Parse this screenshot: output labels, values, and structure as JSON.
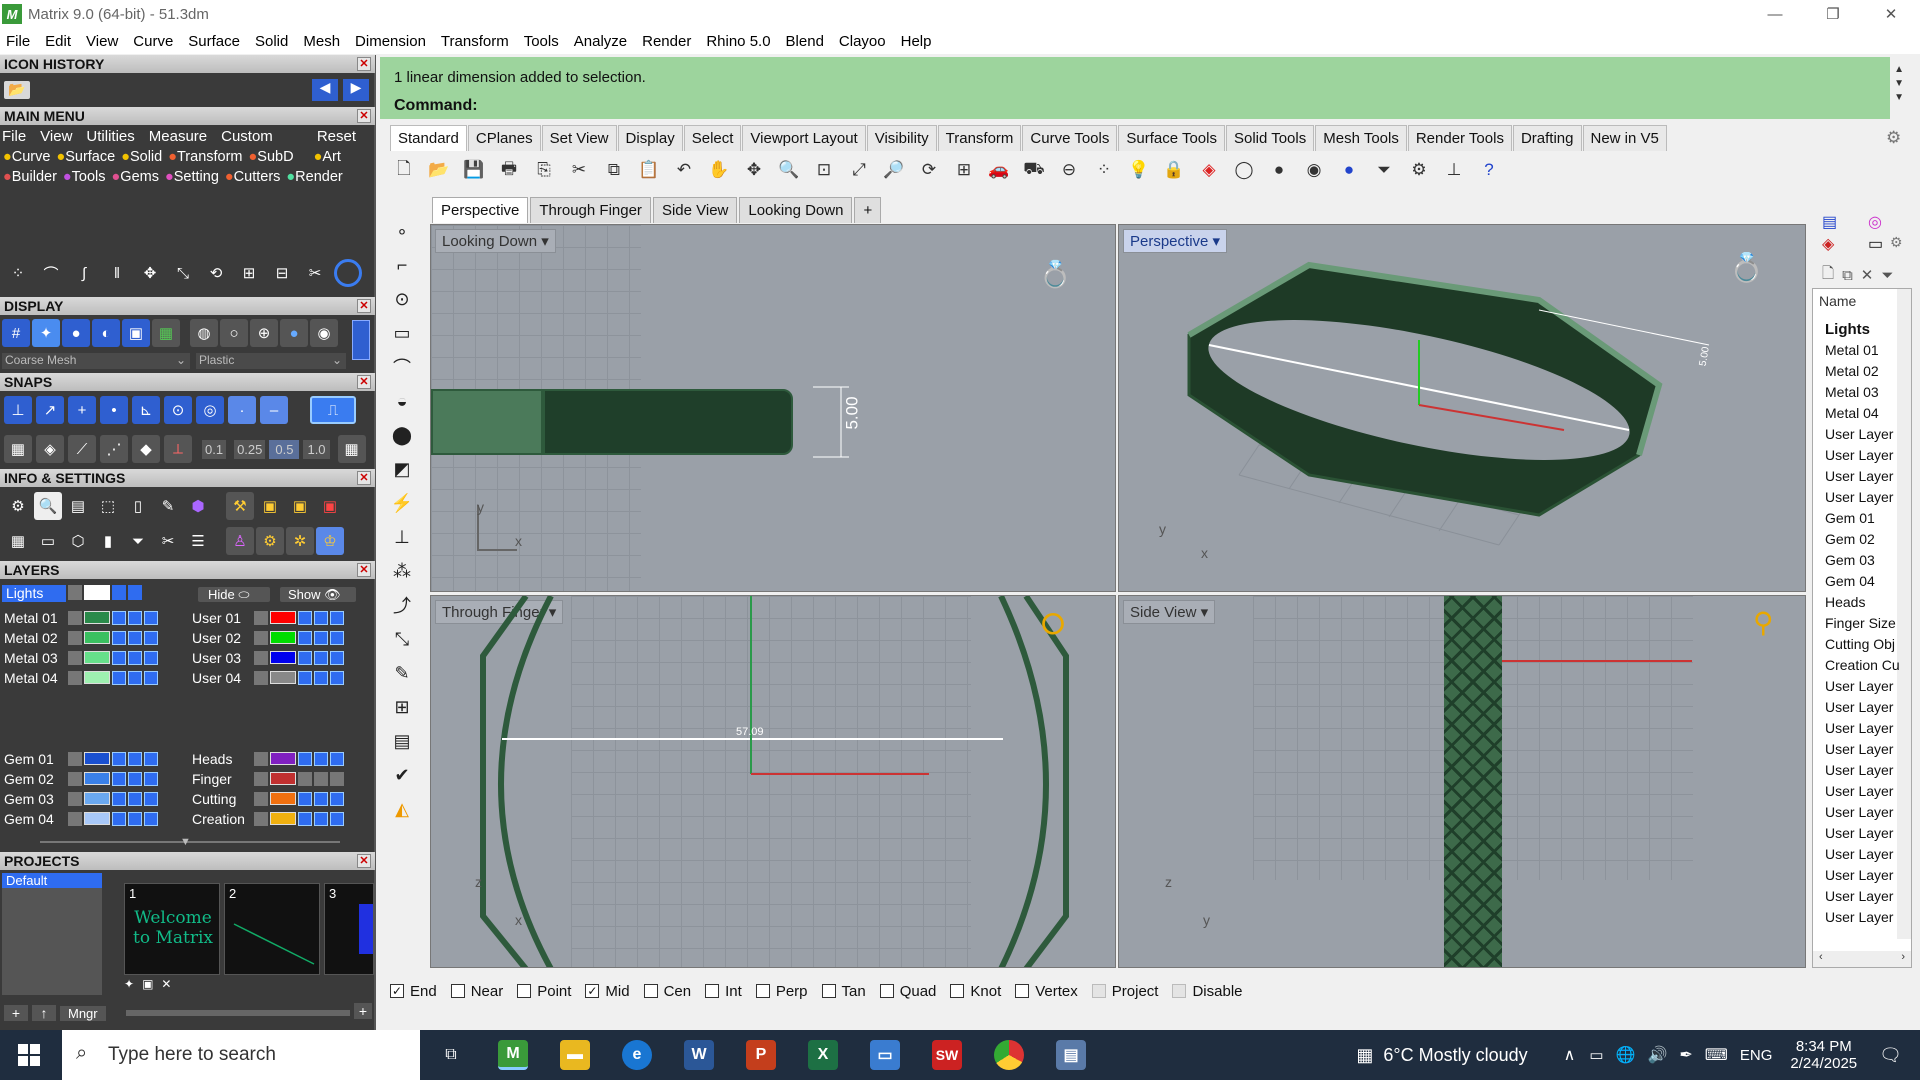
{
  "window": {
    "title": "Matrix 9.0 (64-bit) - 51.3dm",
    "controls": [
      "minimize-icon",
      "restore-icon",
      "close-icon"
    ]
  },
  "menu": [
    "File",
    "Edit",
    "View",
    "Curve",
    "Surface",
    "Solid",
    "Mesh",
    "Dimension",
    "Transform",
    "Tools",
    "Analyze",
    "Render",
    "Rhino 5.0",
    "Blend",
    "Clayoo",
    "Help"
  ],
  "panels": {
    "icon_history": "ICON HISTORY",
    "main_menu": "MAIN MENU",
    "main_menu_items": [
      "File",
      "View",
      "Utilities",
      "Measure",
      "Custom",
      "Reset"
    ],
    "main_menu_row1": [
      "Curve",
      "Surface",
      "Solid",
      "Transform",
      "SubD",
      "Art"
    ],
    "main_menu_row2": [
      "Builder",
      "Tools",
      "Gems",
      "Setting",
      "Cutters",
      "Render"
    ],
    "display": "DISPLAY",
    "display_mesh": "Coarse Mesh",
    "display_material": "Plastic",
    "snaps": "SNAPS",
    "snap_values": [
      "0.1",
      "0.25",
      "0.5",
      "1.0"
    ],
    "info": "INFO & SETTINGS",
    "layers": "LAYERS",
    "layers_current": "Lights",
    "layers_hide": "Hide",
    "layers_show": "Show",
    "layers_left": [
      "Metal 01",
      "Metal 02",
      "Metal 03",
      "Metal 04",
      "Gem 01",
      "Gem 02",
      "Gem 03",
      "Gem 04"
    ],
    "layers_right": [
      "User 01",
      "User 02",
      "User 03",
      "User 04",
      "Heads",
      "Finger",
      "Cutting",
      "Creation"
    ],
    "projects": "PROJECTS",
    "projects_default": "Default",
    "project_slots": [
      "1",
      "2",
      "3"
    ],
    "project_1_text": "Welcome to Matrix",
    "projects_mngr": "Mngr"
  },
  "command": {
    "message": "1 linear dimension added to selection.",
    "prompt": "Command:"
  },
  "toolbar_tabs": [
    "Standard",
    "CPlanes",
    "Set View",
    "Display",
    "Select",
    "Viewport Layout",
    "Visibility",
    "Transform",
    "Curve Tools",
    "Surface Tools",
    "Solid Tools",
    "Mesh Tools",
    "Render Tools",
    "Drafting",
    "New in V5"
  ],
  "viewport_tabs": [
    "Perspective",
    "Through Finger",
    "Side View",
    "Looking Down"
  ],
  "viewports": {
    "top_left": {
      "label": "Looking Down",
      "dimension": "5.00"
    },
    "top_right": {
      "label": "Perspective",
      "dimension": "5.00"
    },
    "bottom_left": {
      "label": "Through Finger",
      "dimension": "57.09"
    },
    "bottom_right": {
      "label": "Side View"
    }
  },
  "axes": {
    "x": "x",
    "y": "y",
    "z": "z"
  },
  "layers_panel": {
    "header": "Name",
    "items": [
      "Lights",
      "Metal 01",
      "Metal 02",
      "Metal 03",
      "Metal 04",
      "User Layer",
      "User Layer",
      "User Layer",
      "User Layer",
      "Gem 01",
      "Gem 02",
      "Gem 03",
      "Gem 04",
      "Heads",
      "Finger Size",
      "Cutting Obj",
      "Creation Cu",
      "User Layer",
      "User Layer",
      "User Layer",
      "User Layer",
      "User Layer",
      "User Layer",
      "User Layer",
      "User Layer",
      "User Layer",
      "User Layer",
      "User Layer",
      "User Layer"
    ]
  },
  "osnaps": [
    {
      "label": "End",
      "checked": true
    },
    {
      "label": "Near",
      "checked": false
    },
    {
      "label": "Point",
      "checked": false
    },
    {
      "label": "Mid",
      "checked": true
    },
    {
      "label": "Cen",
      "checked": false
    },
    {
      "label": "Int",
      "checked": false
    },
    {
      "label": "Perp",
      "checked": false
    },
    {
      "label": "Tan",
      "checked": false
    },
    {
      "label": "Quad",
      "checked": false
    },
    {
      "label": "Knot",
      "checked": false
    },
    {
      "label": "Vertex",
      "checked": false
    },
    {
      "label": "Project",
      "checked": false
    },
    {
      "label": "Disable",
      "checked": false
    }
  ],
  "taskbar": {
    "search_placeholder": "Type here to search",
    "weather": "6°C  Mostly cloudy",
    "language": "ENG",
    "time": "8:34 PM",
    "date": "2/24/2025",
    "apps": [
      "task-view",
      "matrix",
      "file-explorer",
      "edge",
      "word",
      "powerpoint",
      "excel",
      "screen",
      "solidworks",
      "chrome",
      "remote"
    ],
    "solidworks_label": "SW"
  }
}
